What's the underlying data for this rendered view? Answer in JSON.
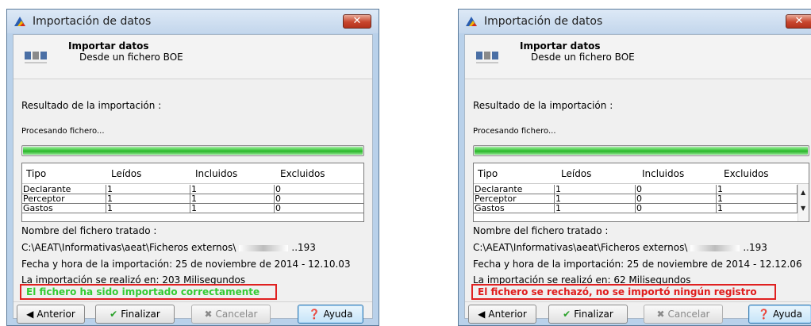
{
  "colors": {
    "success": "#33cc33",
    "error": "#e01c1c",
    "progress": "#2fbf2f",
    "highlight_border": "#e02020"
  },
  "dialogs": [
    {
      "title": "Importación de datos",
      "header_title": "Importar datos",
      "header_subtitle": "Desde un fichero BOE",
      "result_label": "Resultado de la importación :",
      "processing": "Procesando fichero...",
      "progress_fraction": 1.0,
      "columns": [
        "Tipo",
        "Leídos",
        "Incluidos",
        "Excluidos"
      ],
      "rows": [
        [
          "Declarante",
          "1",
          "1",
          "0"
        ],
        [
          "Perceptor",
          "1",
          "1",
          "0"
        ],
        [
          "Gastos",
          "1",
          "1",
          "0"
        ]
      ],
      "file_label": "Nombre del fichero tratado :",
      "file_path": "C:\\AEAT\\Informativas\\aeat\\Ficheros externos\\",
      "file_suffix": "..193",
      "date_line": "Fecha y hora de la importación: 25 de noviembre de 2014 - 12.10.03",
      "time_line": "La importación se realizó en: 203 Milisegundos",
      "message": "El fichero ha sido importado correctamente",
      "buttons": {
        "prev": "Anterior",
        "finish": "Finalizar",
        "cancel": "Cancelar",
        "help": "Ayuda"
      }
    },
    {
      "title": "Importación de datos",
      "header_title": "Importar datos",
      "header_subtitle": "Desde un fichero BOE",
      "result_label": "Resultado de la importación :",
      "processing": "Procesando fichero...",
      "progress_fraction": 1.0,
      "columns": [
        "Tipo",
        "Leídos",
        "Incluidos",
        "Excluidos"
      ],
      "rows": [
        [
          "Declarante",
          "1",
          "0",
          "1"
        ],
        [
          "Perceptor",
          "1",
          "0",
          "1"
        ],
        [
          "Gastos",
          "1",
          "0",
          "1"
        ]
      ],
      "file_label": "Nombre del fichero tratado :",
      "file_path": "C:\\AEAT\\Informativas\\aeat\\Ficheros externos\\",
      "file_suffix": "..193",
      "date_line": "Fecha y hora de la importación: 25 de noviembre de 2014 - 12.12.06",
      "time_line": "La importación se realizó en: 62 Milisegundos",
      "message": "El fichero se rechazó, no se importó ningún registro",
      "buttons": {
        "prev": "Anterior",
        "finish": "Finalizar",
        "cancel": "Cancelar",
        "help": "Ayuda"
      }
    }
  ]
}
